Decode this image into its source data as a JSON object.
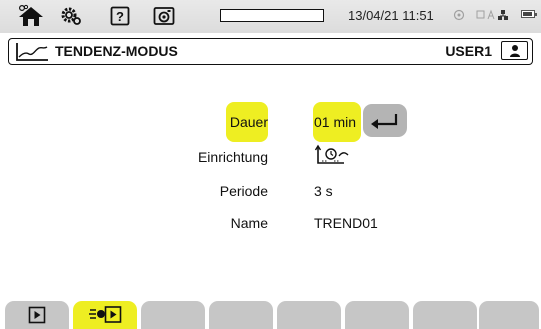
{
  "topbar": {
    "datetime": "13/04/21 11:51",
    "progress_fraction": 0.0,
    "icons": [
      "home-icon",
      "settings-icon",
      "help-icon",
      "camera-icon",
      "grayed-status-icon",
      "connection-icons",
      "battery-icon"
    ]
  },
  "header": {
    "title": "TENDENZ-MODUS",
    "user": "USER1"
  },
  "form": {
    "dauer_label": "Dauer",
    "dauer_value": "01 min",
    "einrichtung_label": "Einrichtung",
    "periode_label": "Periode",
    "periode_value": "3 s",
    "name_label": "Name",
    "name_value": "TREND01"
  },
  "tabs": {
    "count": 8,
    "active_index": 1
  },
  "colors": {
    "highlight": "#eeee22",
    "button_gray": "#b4b4b4",
    "tab_gray": "#c6c6c6"
  }
}
